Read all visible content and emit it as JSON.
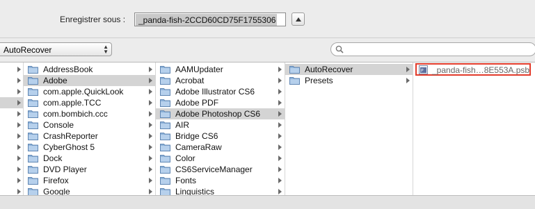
{
  "save_dialog": {
    "label": "Enregistrer sous :",
    "filename_value": "_panda-fish-2CCD60CD75F1755306"
  },
  "toolbar": {
    "location": "AutoRecover"
  },
  "columns": [
    {
      "items": [
        {
          "label": "",
          "selected": false,
          "has_children": true
        },
        {
          "label": "",
          "selected": false,
          "has_children": true
        },
        {
          "label": "",
          "selected": false,
          "has_children": true
        },
        {
          "label": "",
          "selected": true,
          "has_children": true
        },
        {
          "label": "",
          "selected": false,
          "has_children": true
        },
        {
          "label": "",
          "selected": false,
          "has_children": true
        },
        {
          "label": "",
          "selected": false,
          "has_children": true
        },
        {
          "label": "",
          "selected": false,
          "has_children": true
        },
        {
          "label": "",
          "selected": false,
          "has_children": true
        },
        {
          "label": "",
          "selected": false,
          "has_children": true
        },
        {
          "label": "",
          "selected": false,
          "has_children": true
        },
        {
          "label": "",
          "selected": false,
          "has_children": true
        }
      ]
    },
    {
      "items": [
        {
          "label": "AddressBook",
          "selected": false,
          "has_children": true
        },
        {
          "label": "Adobe",
          "selected": true,
          "has_children": true
        },
        {
          "label": "com.apple.QuickLook",
          "selected": false,
          "has_children": true
        },
        {
          "label": "com.apple.TCC",
          "selected": false,
          "has_children": true
        },
        {
          "label": "com.bombich.ccc",
          "selected": false,
          "has_children": true
        },
        {
          "label": "Console",
          "selected": false,
          "has_children": true
        },
        {
          "label": "CrashReporter",
          "selected": false,
          "has_children": true
        },
        {
          "label": "CyberGhost 5",
          "selected": false,
          "has_children": true
        },
        {
          "label": "Dock",
          "selected": false,
          "has_children": true
        },
        {
          "label": "DVD Player",
          "selected": false,
          "has_children": true
        },
        {
          "label": "Firefox",
          "selected": false,
          "has_children": true
        },
        {
          "label": "Google",
          "selected": false,
          "has_children": true
        }
      ]
    },
    {
      "items": [
        {
          "label": "AAMUpdater",
          "selected": false,
          "has_children": true
        },
        {
          "label": "Acrobat",
          "selected": false,
          "has_children": true
        },
        {
          "label": "Adobe Illustrator CS6",
          "selected": false,
          "has_children": true
        },
        {
          "label": "Adobe PDF",
          "selected": false,
          "has_children": true
        },
        {
          "label": "Adobe Photoshop CS6",
          "selected": true,
          "has_children": true
        },
        {
          "label": "AIR",
          "selected": false,
          "has_children": true
        },
        {
          "label": "Bridge CS6",
          "selected": false,
          "has_children": true
        },
        {
          "label": "CameraRaw",
          "selected": false,
          "has_children": true
        },
        {
          "label": "Color",
          "selected": false,
          "has_children": true
        },
        {
          "label": "CS6ServiceManager",
          "selected": false,
          "has_children": true
        },
        {
          "label": "Fonts",
          "selected": false,
          "has_children": true
        },
        {
          "label": "Linguistics",
          "selected": false,
          "has_children": true
        }
      ]
    },
    {
      "items": [
        {
          "label": "AutoRecover",
          "selected": true,
          "has_children": true
        },
        {
          "label": "Presets",
          "selected": false,
          "has_children": true
        }
      ]
    }
  ],
  "file_column": {
    "file_name": "_panda-fish…8E553A.psb",
    "icon": "psb-file-icon",
    "highlight_color": "#e23b2b"
  },
  "colors": {
    "selection": "#d4d4d4",
    "folder": "#8fb3d9"
  }
}
